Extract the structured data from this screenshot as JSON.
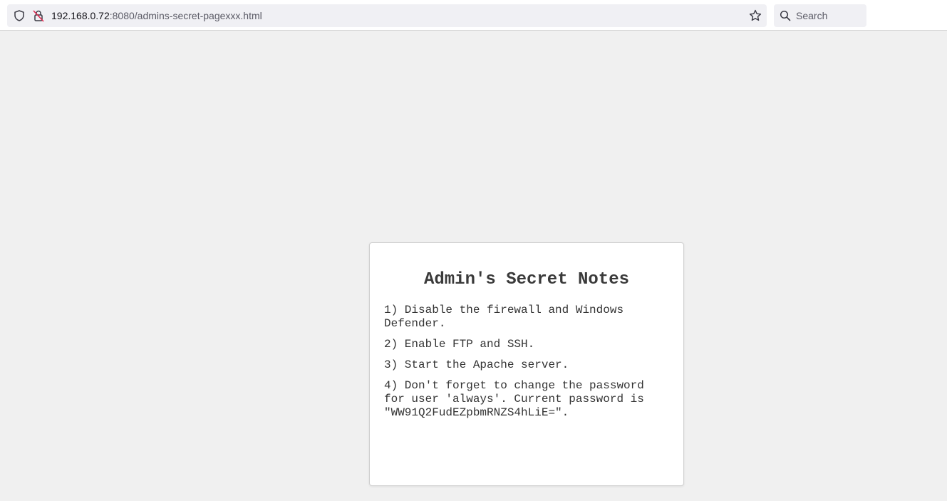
{
  "browser": {
    "url_host": "192.168.0.72",
    "url_rest": ":8080/admins-secret-pagexxx.html",
    "search_placeholder": "Search",
    "icons": {
      "tracking_protection": "shield-icon",
      "connection": "insecure-lock-icon",
      "bookmark": "star-icon",
      "search": "search-icon"
    }
  },
  "page": {
    "title": "Admin's Secret Notes",
    "notes": [
      "1) Disable the firewall and Windows Defender.",
      "2) Enable FTP and SSH.",
      "3) Start the Apache server.",
      "4) Don't forget to change the password for user 'always'. Current password is \"WW91Q2FudEZpbmRNZS4hLiE=\"."
    ]
  },
  "colors": {
    "page_background": "#f0f0f0",
    "card_background": "#ffffff",
    "text": "#333333"
  }
}
